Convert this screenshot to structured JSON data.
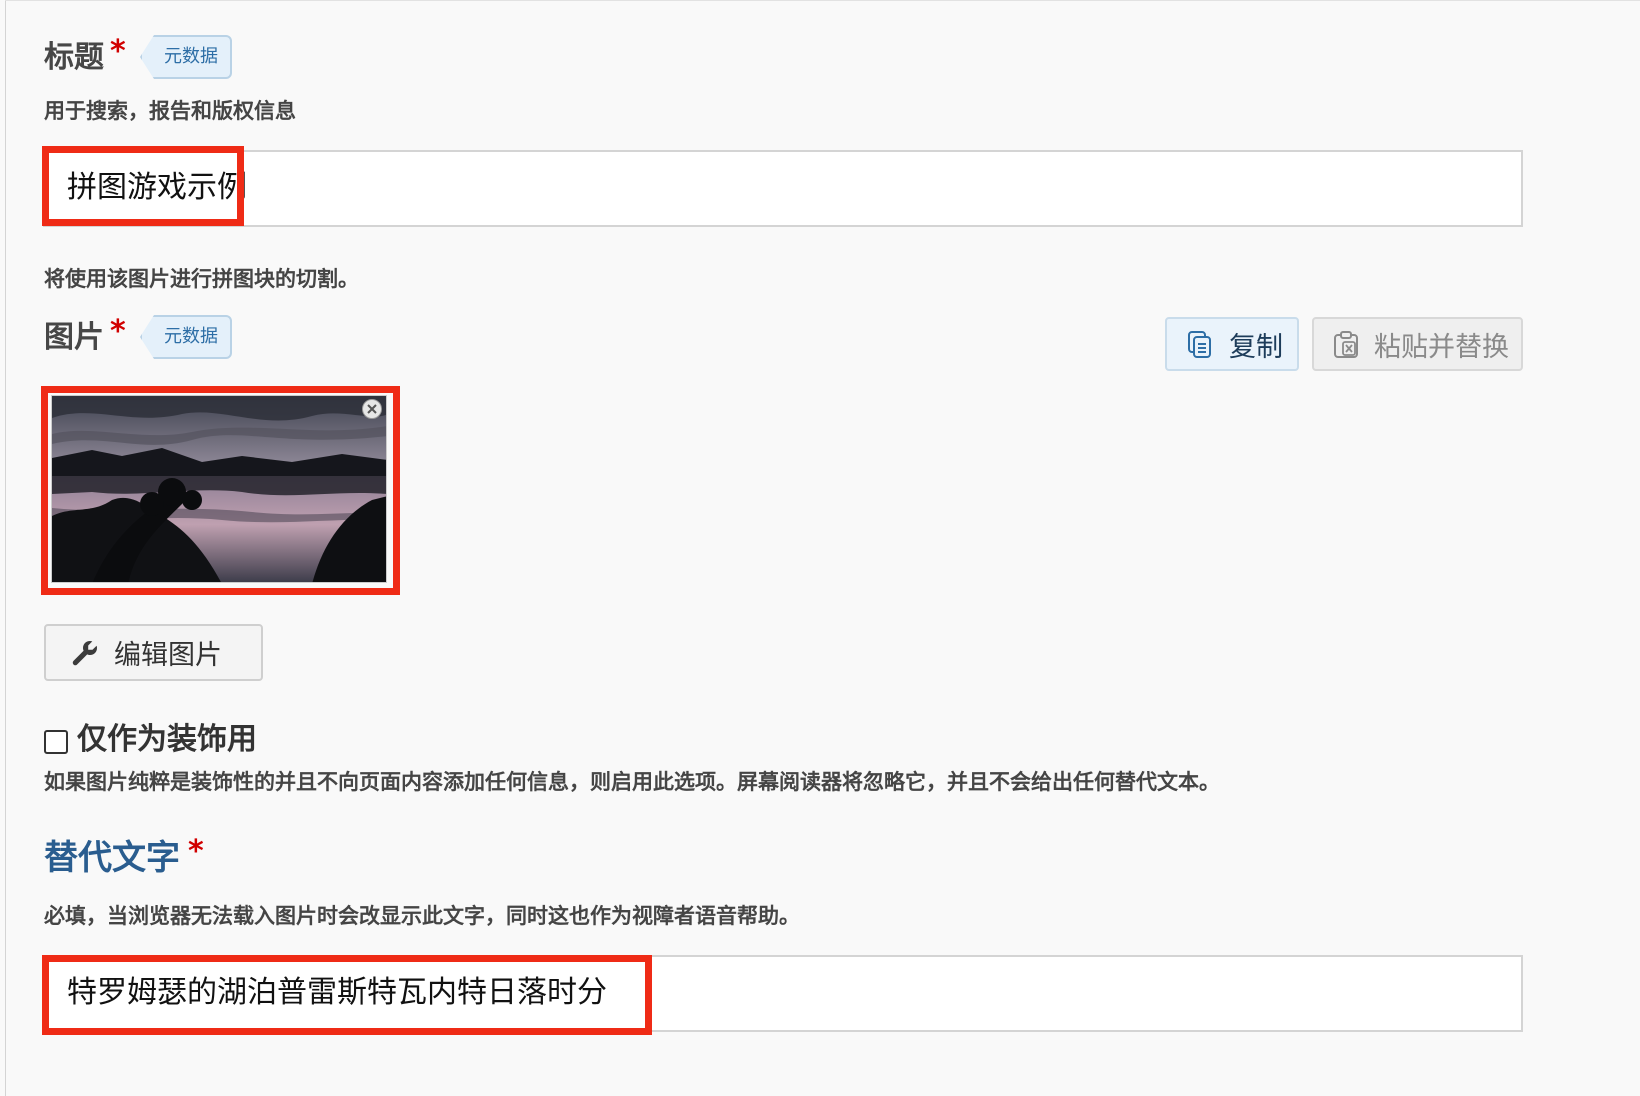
{
  "title_field": {
    "label": "标题",
    "required_mark": "*",
    "badge": "元数据",
    "description": "用于搜索，报告和版权信息",
    "value": "拼图游戏示例"
  },
  "image_field": {
    "pre_description": "将使用该图片进行拼图块的切割。",
    "label": "图片",
    "required_mark": "*",
    "badge": "元数据",
    "copy_button": "复制",
    "paste_button": "粘贴并替换",
    "remove_icon": "close-icon",
    "thumbnail": "sunset-lake-thumbnail",
    "edit_button": "编辑图片"
  },
  "decorative_field": {
    "label": "仅作为装饰用",
    "checked": false,
    "description": "如果图片纯粹是装饰性的并且不向页面内容添加任何信息，则启用此选项。屏幕阅读器将忽略它，并且不会给出任何替代文本。"
  },
  "alt_field": {
    "label": "替代文字",
    "required_mark": "*",
    "description": "必填，当浏览器无法载入图片时会改显示此文字，同时这也作为视障者语音帮助。",
    "value": "特罗姆瑟的湖泊普雷斯特瓦内特日落时分"
  },
  "colors": {
    "required": "#d10000",
    "highlight": "#ef2b16",
    "badge_text": "#2d6ea6",
    "alt_label": "#2a5d8f"
  }
}
